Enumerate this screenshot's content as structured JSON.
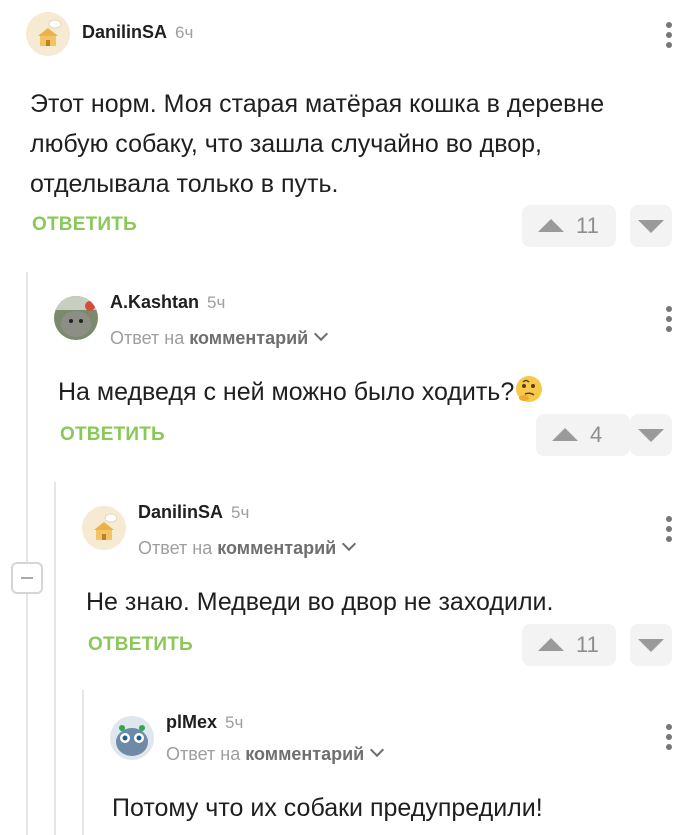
{
  "colors": {
    "accent": "#8ac858",
    "text": "#1f1f1f",
    "muted": "#9e9e9e",
    "vote_bg": "#f3f3f3"
  },
  "ui": {
    "reply_prefix": "Ответ на",
    "reply_link": "комментарий",
    "reply_button": "ОТВЕТИТЬ"
  },
  "comments": [
    {
      "author": "DanilinSA",
      "time": "6ч",
      "text": "Этот норм. Моя старая матёрая кошка в деревне любую собаку, что зашла случайно во двор, отделывала только в путь.",
      "score": "11",
      "avatar_icon": "cook-house-avatar"
    },
    {
      "author": "A.Kashtan",
      "time": "5ч",
      "text": "На медведя с ней можно было ходить?",
      "emoji": "thinking-face",
      "score": "4",
      "avatar_icon": "cat-photo-avatar"
    },
    {
      "author": "DanilinSA",
      "time": "5ч",
      "text": "Не знаю. Медведи во двор не заходили.",
      "score": "11",
      "avatar_icon": "cook-house-avatar"
    },
    {
      "author": "plMex",
      "time": "5ч",
      "text": "Потому что их собаки предупредили!",
      "avatar_icon": "cartoon-cat-avatar"
    }
  ]
}
